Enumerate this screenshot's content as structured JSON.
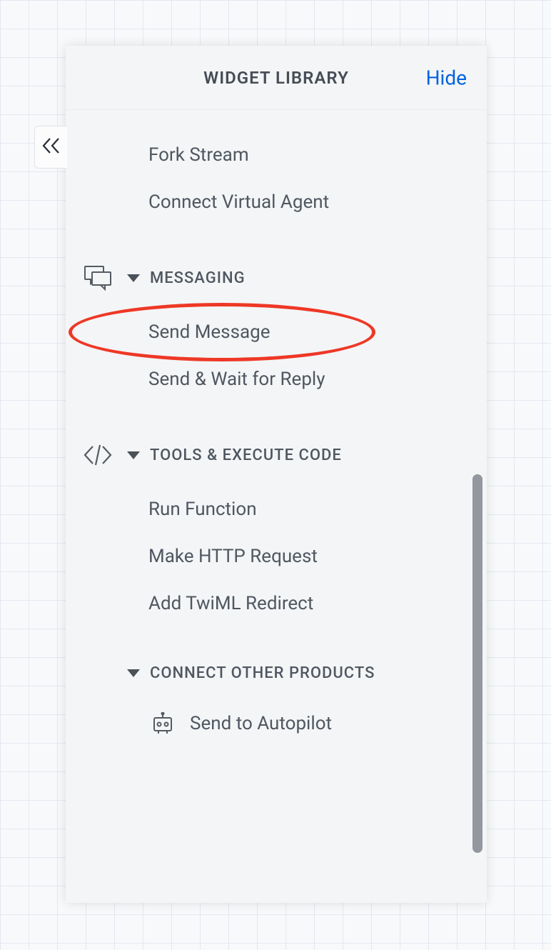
{
  "header": {
    "title": "WIDGET LIBRARY",
    "hide_label": "Hide"
  },
  "top_items": [
    {
      "label": "Fork Stream"
    },
    {
      "label": "Connect Virtual Agent"
    }
  ],
  "sections": [
    {
      "key": "messaging",
      "label": "MESSAGING",
      "icon": "speech-bubbles-icon",
      "items": [
        {
          "label": "Send Message",
          "highlighted": true
        },
        {
          "label": "Send & Wait for Reply"
        }
      ]
    },
    {
      "key": "tools",
      "label": "TOOLS & EXECUTE CODE",
      "icon": "code-brackets-icon",
      "items": [
        {
          "label": "Run Function"
        },
        {
          "label": "Make HTTP Request"
        },
        {
          "label": "Add TwiML Redirect"
        }
      ]
    },
    {
      "key": "connect",
      "label": "CONNECT OTHER PRODUCTS",
      "icon": null,
      "items": [
        {
          "label": "Send to Autopilot",
          "icon": "autopilot-icon"
        }
      ]
    }
  ]
}
